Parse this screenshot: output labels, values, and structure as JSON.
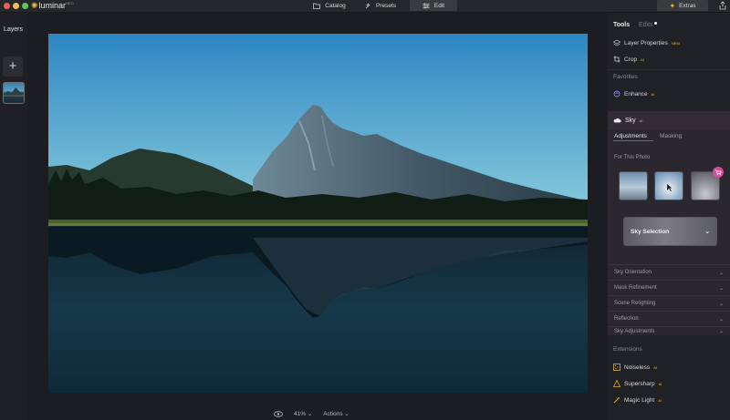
{
  "app": {
    "brand": "luminar",
    "brand_badge": "NEO"
  },
  "topnav": {
    "catalog": "Catalog",
    "presets": "Presets",
    "edit": "Edit",
    "extras": "Extras"
  },
  "layers": {
    "title": "Layers",
    "add": "+"
  },
  "canvas": {
    "zoom": "41%",
    "zoom_caret": "⌄",
    "actions": "Actions",
    "actions_caret": "⌄"
  },
  "right": {
    "tabs": {
      "tools": "Tools",
      "edits": "Edits"
    },
    "items": {
      "layer_properties": "Layer Properties",
      "layer_properties_badge": "NEW",
      "crop": "Crop",
      "enhance": "Enhance",
      "star": "AI"
    },
    "favorites_label": "Favorites",
    "sky": {
      "title": "Sky",
      "tab_adjustments": "Adjustments",
      "tab_masking": "Masking",
      "for_this_photo": "For This Photo",
      "selection_label": "Sky Selection",
      "selection_caret": "⌄",
      "rows": [
        "Sky Orientation",
        "Mask Refinement",
        "Scene Relighting",
        "Reflection",
        "Sky Adjustments"
      ],
      "row_caret": "⌄"
    },
    "extensions_label": "Extensions",
    "extensions": [
      "Noiseless",
      "Supersharp",
      "Magic Light"
    ]
  },
  "colors": {
    "accent_sun": "#f0b53a",
    "cart_badge": "#d64a97",
    "sky_header": "#332c37"
  }
}
